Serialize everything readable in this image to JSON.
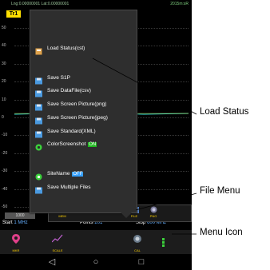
{
  "status_bar": {
    "coords": "Lng:0.00000001 Lat:0.00000001",
    "time": "2015m:sR"
  },
  "trace_tab": "Tr1",
  "y_ticks": [
    "50",
    "40",
    "30",
    "20",
    "10",
    "0",
    "-10",
    "-20",
    "-30",
    "-40",
    "-50"
  ],
  "popup_menu": {
    "items": [
      {
        "label": "Load Status(cst)",
        "icon": "load-status-icon"
      },
      {
        "label": "Save S1P",
        "icon": "save-icon"
      },
      {
        "label": "Save DataFile(csv)",
        "icon": "save-icon"
      },
      {
        "label": "Save Screen Picture(png)",
        "icon": "save-icon"
      },
      {
        "label": "Save Screen Picture(jpeg)",
        "icon": "save-icon"
      },
      {
        "label": "Save Standard(XML)",
        "icon": "save-icon"
      },
      {
        "label": "ColorScreenshot",
        "icon": "color-screenshot-icon",
        "toggle": "ON"
      },
      {
        "label": "SiteName",
        "icon": "site-name-icon",
        "toggle": "OFF"
      },
      {
        "label": "Save Multiple Files",
        "icon": "save-icon"
      }
    ]
  },
  "sub_toolbar": {
    "mem": "MEM",
    "file": "FILE",
    "png": "PNG"
  },
  "bottom_strip": {
    "scale_value": "1000",
    "start_label": "Start",
    "start_value": "1 MHz",
    "points_label": "Points",
    "points_value": "201",
    "stop_label": "Stop",
    "stop_value": "600 MHz"
  },
  "toolbar": {
    "mkr": "MKR",
    "scale": "SCALE",
    "cal": "CAL"
  },
  "nav": {
    "back": "◁",
    "home": "○",
    "recents": "□"
  },
  "callouts": {
    "load_status": "Load Status",
    "file_menu": "File Menu",
    "menu_icon": "Menu Icon"
  }
}
